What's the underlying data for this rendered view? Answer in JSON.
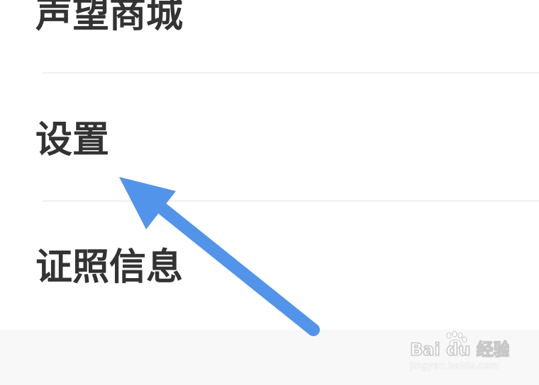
{
  "menu": {
    "items": [
      {
        "label": "声望商城"
      },
      {
        "label": "设置"
      },
      {
        "label": "证照信息"
      }
    ]
  },
  "watermark": {
    "brand": "Bai du 经验",
    "site": "jingyan.baidu.com"
  },
  "colors": {
    "arrow": "#5294ea",
    "text": "#333333",
    "divider": "#efefef",
    "bottom_band": "#f8f8f8"
  }
}
